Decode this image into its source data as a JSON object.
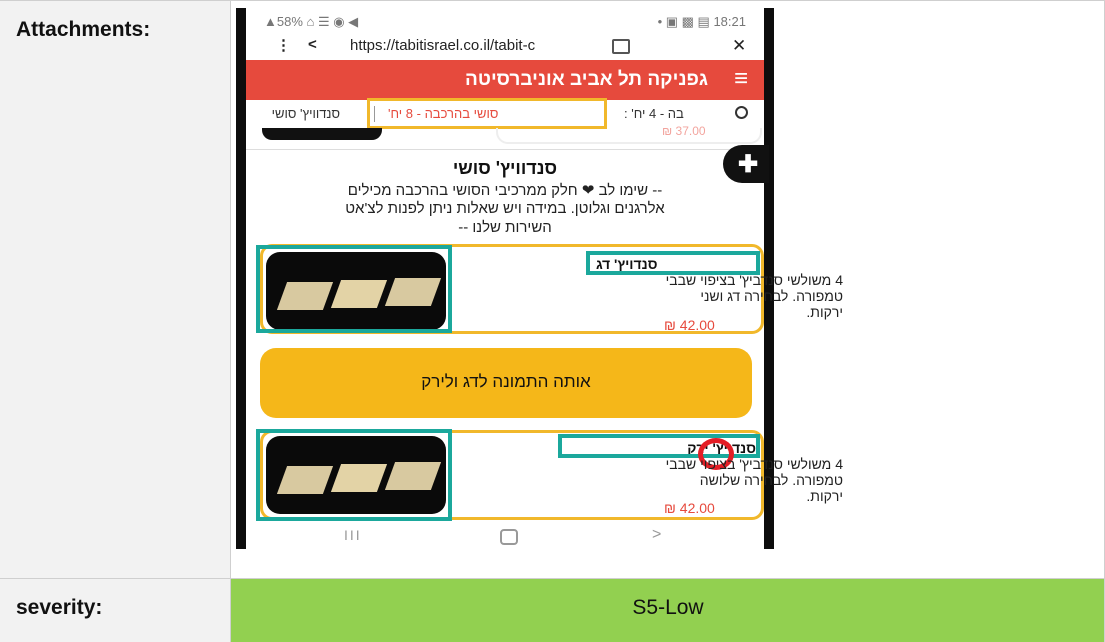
{
  "row1": {
    "label": "Attachments:"
  },
  "row2": {
    "label": "severity:",
    "value": "S5-Low",
    "value_bg": "#92d050"
  },
  "phone": {
    "status": {
      "left": "▲58% ⌂ ☰ ◉ ◀",
      "right": "• ▣ ▩ ▤ 18:21"
    },
    "url": {
      "menu": "⋮",
      "share": "<",
      "text": "https://tabitisrael.co.il/tabit-c",
      "lock": "🔒",
      "close": "✕"
    },
    "header": {
      "title": "גפניקה תל אביב אוניברסיטה",
      "menu_icon": "≡",
      "color": "#e64a3d"
    },
    "tabs": {
      "search_icon": "🔍",
      "t1": "בה - 4 יח' :",
      "t2": "סושי בהרכבה - 8 יח'",
      "t3": "סנדוויץ' סושי"
    },
    "prev_price": "₪ 37.00",
    "section": {
      "title": "סנדוויץ' סושי",
      "desc1": "-- שימו לב ❤ חלק ממרכיבי הסושי בהרכבה מכילים",
      "desc2": "אלרגנים וגלוטן. במידה ויש שאלות ניתן לפנות לצ'אט",
      "desc3": "השירות שלנו --"
    },
    "item1": {
      "name": "סנדויץ' דג",
      "desc1": "4 משולשי סנדביץ' בציפוי שבבי",
      "desc2": "טמפורה. לבחירה דג ושני",
      "desc3": "ירקות.",
      "price": "₪ 42.00"
    },
    "note": {
      "text": "אותה התמונה לדג ולירק",
      "bg": "#f5b719"
    },
    "item2": {
      "name": "סנדויץ' ירק",
      "desc1": "4 משולשי סנדביץ' בציפוי שבבי",
      "desc2": "טמפורה. לבחירה שלושה",
      "desc3": "ירקות.",
      "price": "₪ 42.00"
    },
    "nav": {
      "recent": "III",
      "home": "▢",
      "back": ">"
    },
    "accessibility_icon": "♿"
  }
}
